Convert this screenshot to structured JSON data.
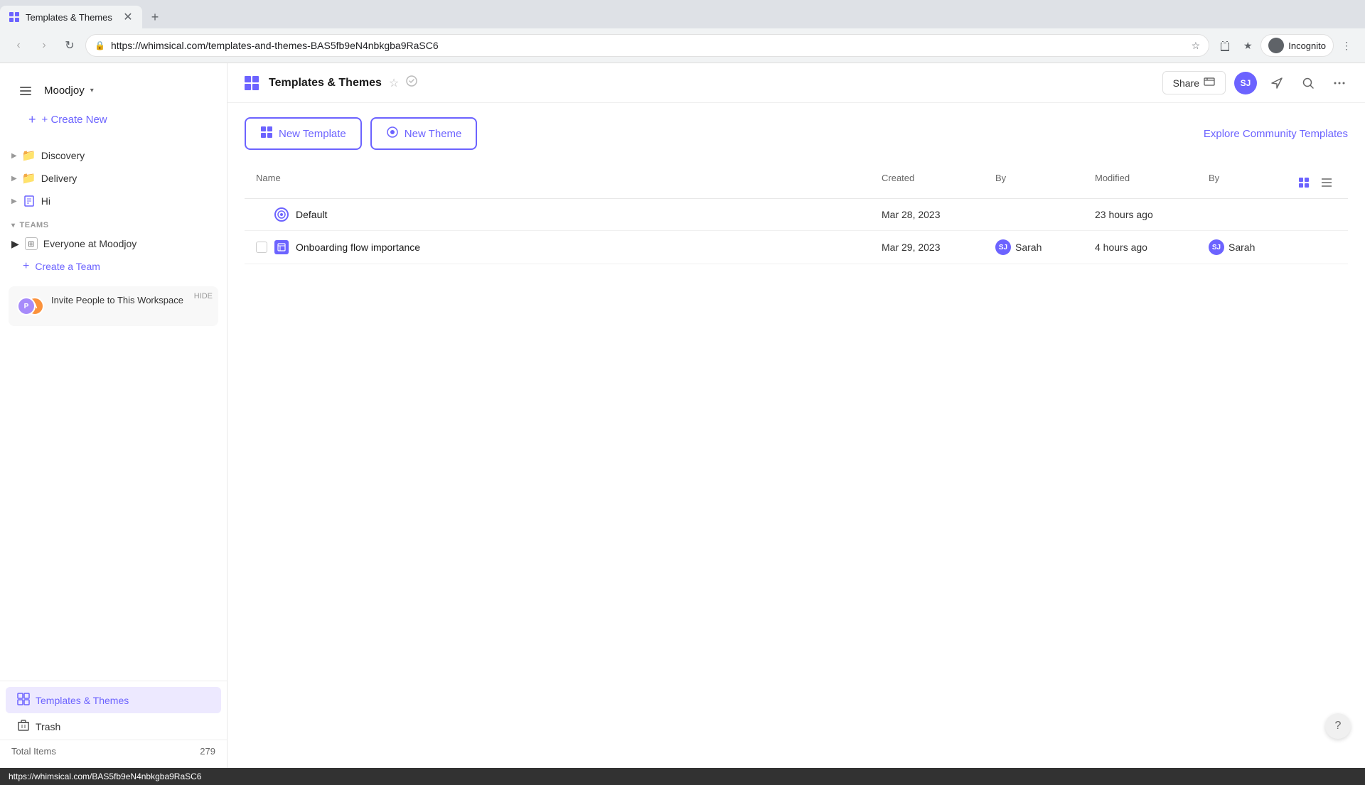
{
  "browser": {
    "tab_title": "Templates & Themes",
    "tab_favicon": "⊞",
    "url": "whimsical.com/templates-and-themes-BAS5fb9eN4nbkgba9RaSC6",
    "full_url": "https://whimsical.com/templates-and-themes-BAS5fb9eN4nbkgba9RaSC6",
    "incognito_label": "Incognito"
  },
  "sidebar": {
    "workspace_name": "Moodjoy",
    "create_new_label": "+ Create New",
    "nav_items": [
      {
        "label": "Discovery",
        "icon": "folder",
        "has_arrow": true
      },
      {
        "label": "Delivery",
        "icon": "folder",
        "has_arrow": true
      },
      {
        "label": "Hi",
        "icon": "doc",
        "has_arrow": true
      }
    ],
    "teams_section_label": "TEAMS",
    "teams": [
      {
        "label": "Everyone at Moodjoy",
        "has_arrow": true
      }
    ],
    "create_team_label": "Create a Team",
    "invite_banner": {
      "hide_label": "HIDE",
      "title": "Invite People to This Workspace",
      "subtitle": ""
    },
    "bottom_nav": [
      {
        "label": "Templates & Themes",
        "icon": "grid",
        "active": true
      },
      {
        "label": "Trash",
        "icon": "trash",
        "active": false
      }
    ],
    "total_items_label": "Total Items",
    "total_items_count": "279"
  },
  "header": {
    "title": "Templates & Themes",
    "share_label": "Share",
    "user_initials": "SJ",
    "menu_label": "☰"
  },
  "content": {
    "new_template_label": "New Template",
    "new_theme_label": "New Theme",
    "explore_label": "Explore Community Templates",
    "table_columns": {
      "name": "Name",
      "created": "Created",
      "by": "By",
      "modified": "Modified",
      "by2": "By"
    },
    "rows": [
      {
        "name": "Default",
        "type": "theme",
        "created": "Mar 28, 2023",
        "created_by": "",
        "modified": "23 hours ago",
        "modified_by": "",
        "modified_by_initials": ""
      },
      {
        "name": "Onboarding flow importance",
        "type": "template",
        "created": "Mar 29, 2023",
        "created_by": "Sarah",
        "created_by_initials": "SJ",
        "modified": "4 hours ago",
        "modified_by": "Sarah",
        "modified_by_initials": "SJ"
      }
    ]
  },
  "status_bar": {
    "url": "https://whimsical.com/BAS5fb9eN4nbkgba9RaSC6"
  },
  "help_btn_label": "?"
}
